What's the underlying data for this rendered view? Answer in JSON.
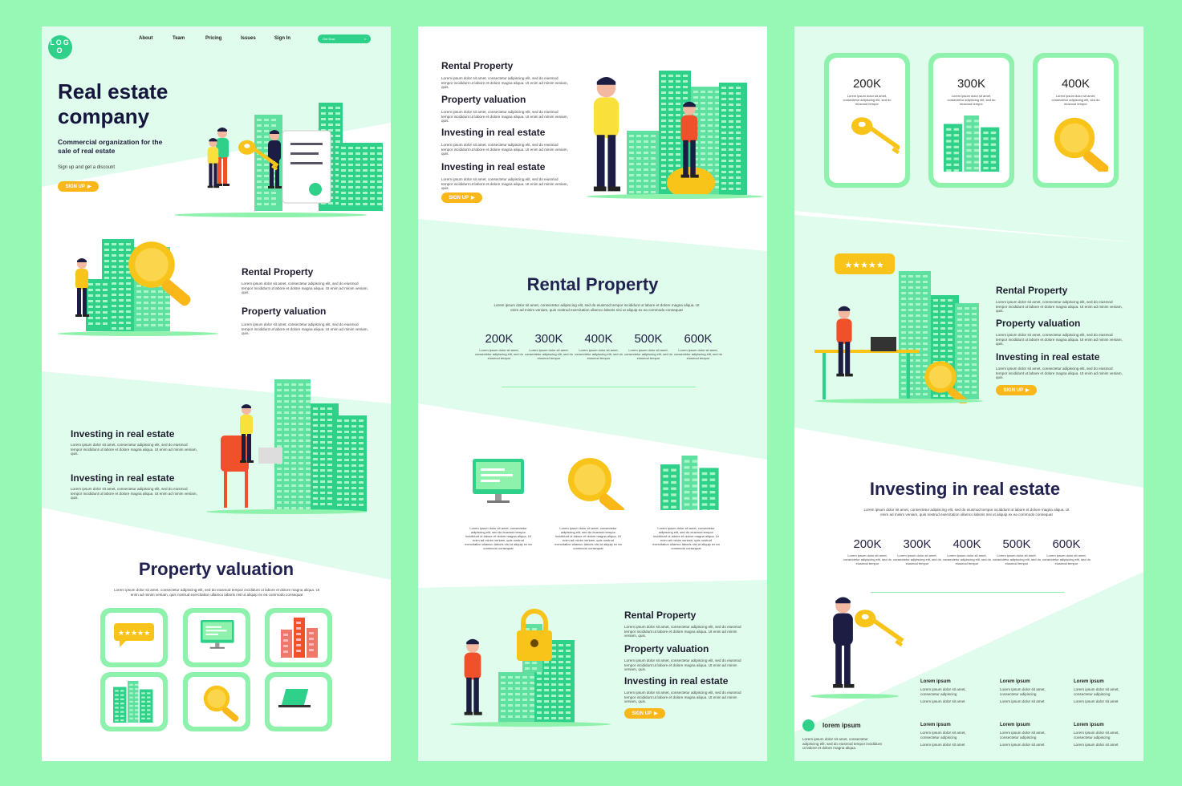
{
  "colors": {
    "background": "#97f8b5",
    "mint": "#e0fcec",
    "accent_green": "#2fd08a",
    "yellow": "#f9b71a",
    "navy": "#1d1d44"
  },
  "lorem": {
    "short": "Lorem ipsum dolor sit amet, consectetur adipiscing elit, sed do eiusmod tempor incididunt ut labore et dolore magna aliqua. Ut enim ad minim veniam, quis.",
    "center": "Lorem ipsum dolor sit amet, consectetur adipiscing elit, sed do eiusmod tempor incididunt ut labore et dolore magna aliqua. Ut enim ad minim veniam, quis nostrud exercitation ullamco laboris nisi ut aliquip ex ea commodo consequat",
    "stat": "Lorem ipsum dolor sit amet, consectetur adipiscing elit, sed do eiusmod tempor",
    "icon": "Lorem ipsum dolor sit amet, consectetur adipiscing elit, sed do eiusmod tempor incididunt ut labore et dolore magna aliqua. Ut enim ad minim veniam, quis nostrud exercitation ullamco laboris nisi ut aliquip ex ea commodo consequat"
  },
  "panel1": {
    "logo": "LOGO",
    "nav": [
      "About",
      "Team",
      "Pricing",
      "Issues",
      "Sign In"
    ],
    "search_label": "Get Now",
    "hero_title_line1": "Real estate",
    "hero_title_line2": "company",
    "hero_subtitle": "Commercial organization for the sale of real estate",
    "hero_note": "Sign up and get a discount",
    "signup": "SIGN UP",
    "section2": [
      "Rental Property",
      "Property valuation"
    ],
    "section3": [
      "Investing in real estate",
      "Investing in real estate"
    ],
    "valuation_title": "Property valuation",
    "tiles": [
      "rating-stars",
      "monitor",
      "buildings",
      "buildings-green",
      "magnifier",
      "laptop"
    ]
  },
  "panel2": {
    "list": [
      "Rental Property",
      "Property valuation",
      "Investing in real estate",
      "Investing in real estate"
    ],
    "signup": "SIGN UP",
    "rental_title": "Rental Property",
    "stats": [
      "200K",
      "300K",
      "400K",
      "500K",
      "600K"
    ],
    "icons": [
      "monitor",
      "magnifier",
      "buildings"
    ],
    "bottom_list": [
      "Rental Property",
      "Property valuation",
      "Investing in real estate"
    ],
    "bottom_signup": "SIGN UP"
  },
  "panel3": {
    "cards": [
      {
        "value": "200K",
        "icon": "key"
      },
      {
        "value": "300K",
        "icon": "buildings"
      },
      {
        "value": "400K",
        "icon": "magnifier"
      }
    ],
    "list": [
      "Rental Property",
      "Property valuation",
      "Investing in real estate"
    ],
    "signup": "SIGN UP",
    "investing_title": "Investing in real estate",
    "stats": [
      "200K",
      "300K",
      "400K",
      "500K",
      "600K"
    ],
    "footer": {
      "brand": "lorem ipsum",
      "brand_text": "Lorem ipsum dolor sit amet, consectetur adipiscing elit, sed do eiusmod tempor incididunt ut labore et dolore magna aliqua.",
      "col_title": "Lorem ipsum",
      "line1": "Lorem ipsum dolor sit amet, consectetur adipiscing",
      "line2": "Lorem ipsum dolor sit amet"
    }
  }
}
